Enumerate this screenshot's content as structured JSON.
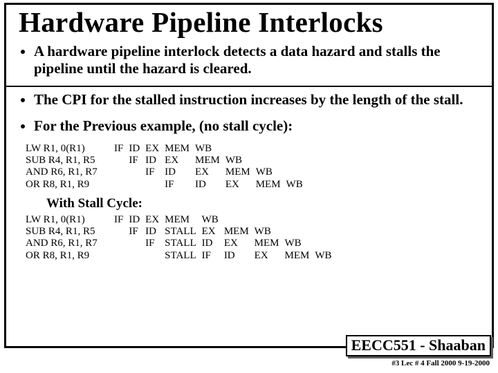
{
  "title": "Hardware Pipeline Interlocks",
  "bullets": [
    "A hardware pipeline interlock detects a data hazard and stalls the pipeline until the hazard is cleared.",
    "The CPI for the stalled instruction increases by the length of the stall.",
    "For the Previous example,  (no stall cycle):"
  ],
  "table1": {
    "rows": [
      {
        "instr": "LW R1, 0(R1)",
        "c": [
          "IF",
          "ID",
          "EX",
          "MEM",
          "WB",
          "",
          "",
          ""
        ]
      },
      {
        "instr": "SUB R4, R1, R5",
        "c": [
          "",
          "IF",
          "ID",
          "EX",
          "MEM",
          "WB",
          "",
          ""
        ]
      },
      {
        "instr": "AND R6, R1, R7",
        "c": [
          "",
          "",
          "IF",
          "ID",
          "EX",
          "MEM",
          "WB",
          ""
        ]
      },
      {
        "instr": "OR R8, R1, R9",
        "c": [
          "",
          "",
          "",
          "IF",
          "ID",
          "EX",
          "MEM",
          "WB"
        ]
      }
    ]
  },
  "subhead": "With Stall Cycle:",
  "table2": {
    "rows": [
      {
        "instr": "LW R1, 0(R1)",
        "c": [
          "IF",
          "ID",
          "EX",
          "MEM",
          "WB",
          "",
          "",
          "",
          ""
        ]
      },
      {
        "instr": "SUB R4, R1, R5",
        "c": [
          "",
          "IF",
          "ID",
          "STALL",
          "EX",
          "MEM",
          "WB",
          "",
          ""
        ]
      },
      {
        "instr": "AND R6, R1, R7",
        "c": [
          "",
          "",
          "IF",
          "STALL",
          "ID",
          "EX",
          "MEM",
          "WB",
          ""
        ]
      },
      {
        "instr": "OR R8, R1, R9",
        "c": [
          "",
          "",
          "",
          "STALL",
          "IF",
          "ID",
          "EX",
          "MEM",
          "WB"
        ]
      }
    ]
  },
  "footer_box": "EECC551 - Shaaban",
  "footer_line": "#3   Lec # 4   Fall 2000  9-19-2000"
}
